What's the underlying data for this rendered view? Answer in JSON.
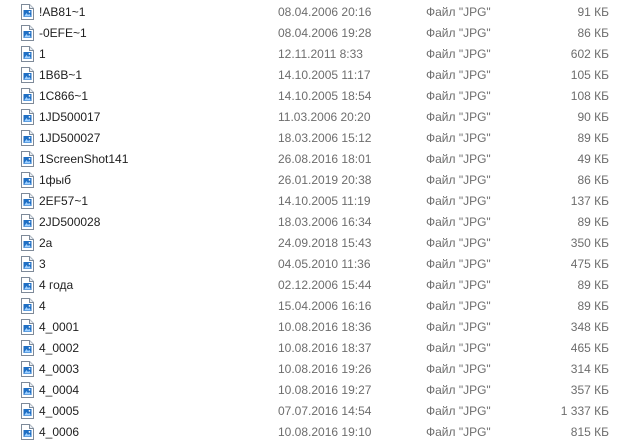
{
  "files": [
    {
      "name": "!AB81~1",
      "date": "08.04.2006 20:16",
      "type": "Файл \"JPG\"",
      "size": "91 КБ",
      "icon": "jpg-file-icon"
    },
    {
      "name": "-0EFE~1",
      "date": "08.04.2006 19:28",
      "type": "Файл \"JPG\"",
      "size": "86 КБ",
      "icon": "jpg-file-icon"
    },
    {
      "name": "1",
      "date": "12.11.2011 8:33",
      "type": "Файл \"JPG\"",
      "size": "602 КБ",
      "icon": "jpg-file-icon"
    },
    {
      "name": "1B6B~1",
      "date": "14.10.2005 11:17",
      "type": "Файл \"JPG\"",
      "size": "105 КБ",
      "icon": "jpg-file-icon"
    },
    {
      "name": "1C866~1",
      "date": "14.10.2005 18:54",
      "type": "Файл \"JPG\"",
      "size": "108 КБ",
      "icon": "jpg-file-icon"
    },
    {
      "name": "1JD500017",
      "date": "11.03.2006 20:20",
      "type": "Файл \"JPG\"",
      "size": "90 КБ",
      "icon": "jpg-file-icon"
    },
    {
      "name": "1JD500027",
      "date": "18.03.2006 15:12",
      "type": "Файл \"JPG\"",
      "size": "89 КБ",
      "icon": "jpg-file-icon"
    },
    {
      "name": "1ScreenShot141",
      "date": "26.08.2016 18:01",
      "type": "Файл \"JPG\"",
      "size": "49 КБ",
      "icon": "jpg-file-icon"
    },
    {
      "name": "1фыб",
      "date": "26.01.2019 20:38",
      "type": "Файл \"JPG\"",
      "size": "86 КБ",
      "icon": "jpg-file-icon"
    },
    {
      "name": "2EF57~1",
      "date": "14.10.2005 11:19",
      "type": "Файл \"JPG\"",
      "size": "137 КБ",
      "icon": "jpg-file-icon"
    },
    {
      "name": "2JD500028",
      "date": "18.03.2006 16:34",
      "type": "Файл \"JPG\"",
      "size": "89 КБ",
      "icon": "jpg-file-icon"
    },
    {
      "name": "2a",
      "date": "24.09.2018 15:43",
      "type": "Файл \"JPG\"",
      "size": "350 КБ",
      "icon": "jpg-file-icon"
    },
    {
      "name": "3",
      "date": "04.05.2010 11:36",
      "type": "Файл \"JPG\"",
      "size": "475 КБ",
      "icon": "jpg-file-icon"
    },
    {
      "name": "4 года",
      "date": "02.12.2006 15:44",
      "type": "Файл \"JPG\"",
      "size": "89 КБ",
      "icon": "jpg-file-icon"
    },
    {
      "name": "4",
      "date": "15.04.2006 16:16",
      "type": "Файл \"JPG\"",
      "size": "89 КБ",
      "icon": "jpg-file-icon"
    },
    {
      "name": "4_0001",
      "date": "10.08.2016 18:36",
      "type": "Файл \"JPG\"",
      "size": "348 КБ",
      "icon": "jpg-file-icon"
    },
    {
      "name": "4_0002",
      "date": "10.08.2016 18:37",
      "type": "Файл \"JPG\"",
      "size": "465 КБ",
      "icon": "jpg-file-icon"
    },
    {
      "name": "4_0003",
      "date": "10.08.2016 19:26",
      "type": "Файл \"JPG\"",
      "size": "314 КБ",
      "icon": "jpg-file-icon"
    },
    {
      "name": "4_0004",
      "date": "10.08.2016 19:27",
      "type": "Файл \"JPG\"",
      "size": "357 КБ",
      "icon": "jpg-file-icon"
    },
    {
      "name": "4_0005",
      "date": "07.07.2016 14:54",
      "type": "Файл \"JPG\"",
      "size": "1 337 КБ",
      "icon": "jpg-file-icon"
    },
    {
      "name": "4_0006",
      "date": "10.08.2016 19:10",
      "type": "Файл \"JPG\"",
      "size": "815 КБ",
      "icon": "jpg-file-icon"
    }
  ]
}
